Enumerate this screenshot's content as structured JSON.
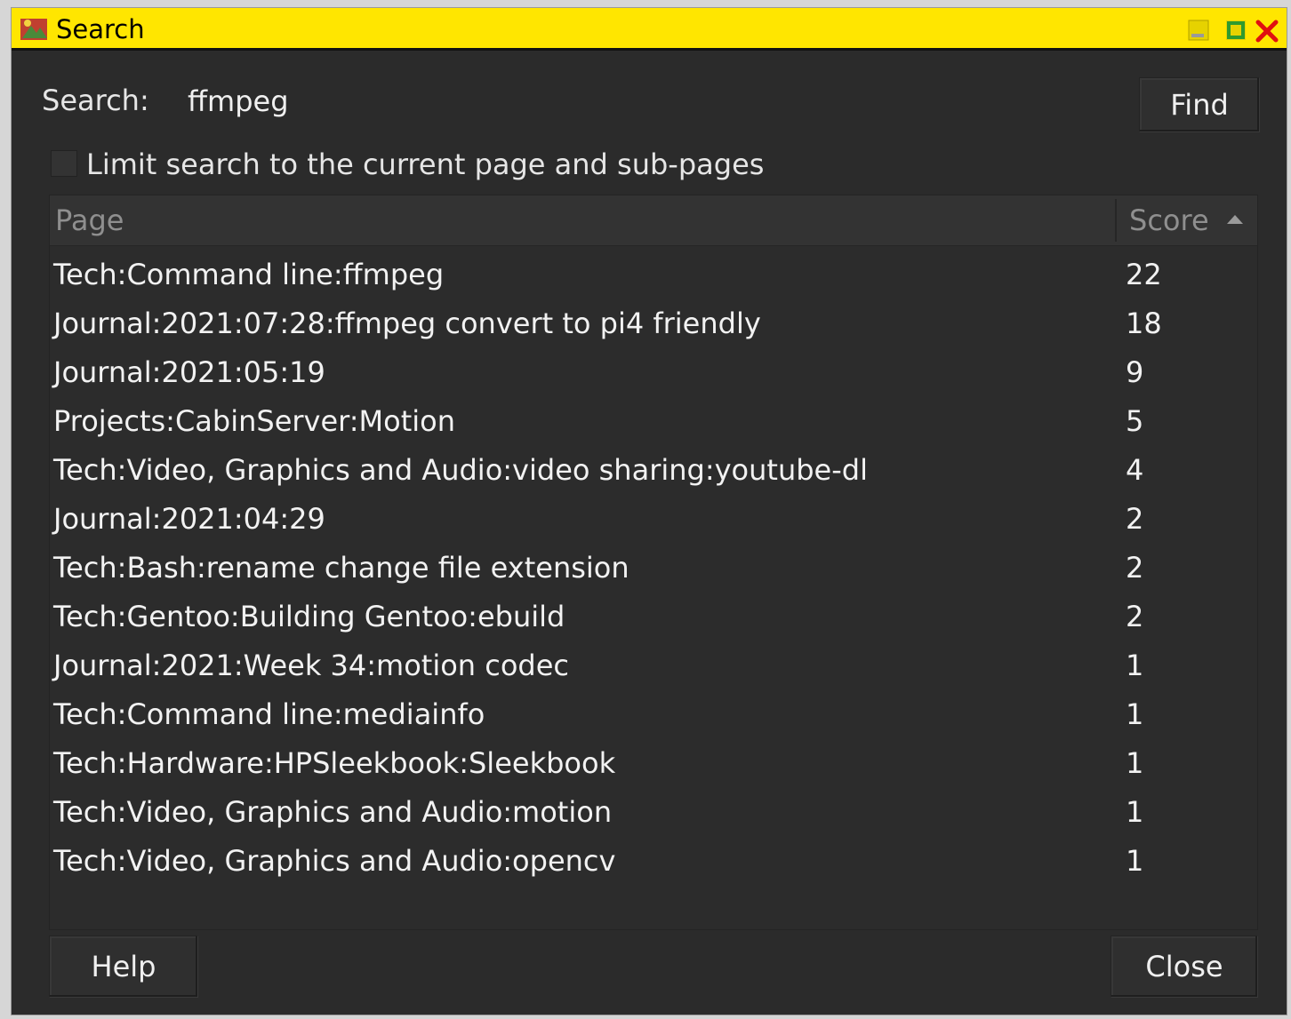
{
  "window": {
    "title": "Search",
    "titlebar_color": "#ffe600"
  },
  "search": {
    "label": "Search:",
    "value": "ffmpeg",
    "find_label": "Find"
  },
  "limit": {
    "label": "Limit search to the current page and sub-pages",
    "checked": false
  },
  "table": {
    "columns": [
      "Page",
      "Score"
    ],
    "sort": {
      "column": "Score",
      "direction": "descending"
    },
    "rows": [
      {
        "page": "Tech:Command line:ffmpeg",
        "score": "22"
      },
      {
        "page": "Journal:2021:07:28:ffmpeg convert to pi4 friendly",
        "score": "18"
      },
      {
        "page": "Journal:2021:05:19",
        "score": "9"
      },
      {
        "page": "Projects:CabinServer:Motion",
        "score": "5"
      },
      {
        "page": "Tech:Video, Graphics and Audio:video sharing:youtube-dl",
        "score": "4"
      },
      {
        "page": "Journal:2021:04:29",
        "score": "2"
      },
      {
        "page": "Tech:Bash:rename change file extension",
        "score": "2"
      },
      {
        "page": "Tech:Gentoo:Building Gentoo:ebuild",
        "score": "2"
      },
      {
        "page": "Journal:2021:Week 34:motion codec",
        "score": "1"
      },
      {
        "page": "Tech:Command line:mediainfo",
        "score": "1"
      },
      {
        "page": "Tech:Hardware:HPSleekbook:Sleekbook",
        "score": "1"
      },
      {
        "page": "Tech:Video, Graphics and Audio:motion",
        "score": "1"
      },
      {
        "page": "Tech:Video, Graphics and Audio:opencv",
        "score": "1"
      }
    ]
  },
  "buttons": {
    "help": "Help",
    "close": "Close"
  }
}
